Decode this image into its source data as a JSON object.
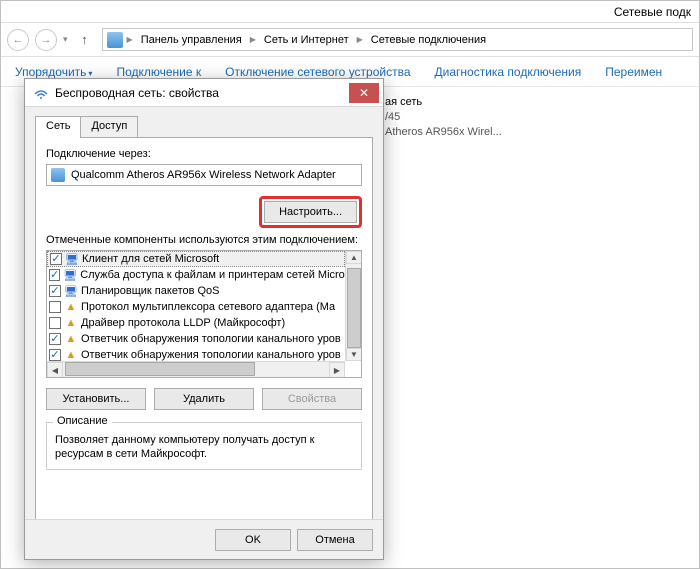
{
  "explorer": {
    "title_fragment": "Сетевые подк",
    "breadcrumbs": [
      "Панель управления",
      "Сеть и Интернет",
      "Сетевые подключения"
    ],
    "toolbar": {
      "organize": "Упорядочить",
      "connect": "Подключение к",
      "disable": "Отключение сетевого устройства",
      "diagnose": "Диагностика подключения",
      "rename": "Переимен"
    },
    "network_item": {
      "line1": "ая сеть",
      "line2": "/45",
      "line3": "Atheros AR956x Wirel..."
    }
  },
  "dialog": {
    "title": "Беспроводная сеть: свойства",
    "tabs": {
      "net": "Сеть",
      "access": "Доступ"
    },
    "connect_via_label": "Подключение через:",
    "adapter": "Qualcomm Atheros AR956x Wireless Network Adapter",
    "configure_btn": "Настроить...",
    "components_label": "Отмеченные компоненты используются этим подключением:",
    "components": [
      {
        "checked": true,
        "icon": "🖥",
        "color": "#2d6fd0",
        "label": "Клиент для сетей Microsoft",
        "selected": true
      },
      {
        "checked": true,
        "icon": "🖥",
        "color": "#2d6fd0",
        "label": "Служба доступа к файлам и принтерам сетей Micro"
      },
      {
        "checked": true,
        "icon": "🖥",
        "color": "#2d6fd0",
        "label": "Планировщик пакетов QoS"
      },
      {
        "checked": false,
        "icon": "▲",
        "color": "#d99a2b",
        "label": "Протокол мультиплексора сетевого адаптера (Ма"
      },
      {
        "checked": false,
        "icon": "▲",
        "color": "#d99a2b",
        "label": "Драйвер протокола LLDP (Майкрософт)"
      },
      {
        "checked": true,
        "icon": "▲",
        "color": "#d99a2b",
        "label": "Ответчик обнаружения топологии канального уров"
      },
      {
        "checked": true,
        "icon": "▲",
        "color": "#d99a2b",
        "label": "Ответчик обнаружения топологии канального уров"
      }
    ],
    "install_btn": "Установить...",
    "uninstall_btn": "Удалить",
    "properties_btn": "Свойства",
    "desc_legend": "Описание",
    "desc_text": "Позволяет данному компьютеру получать доступ к ресурсам в сети Майкрософт.",
    "ok": "OK",
    "cancel": "Отмена"
  }
}
